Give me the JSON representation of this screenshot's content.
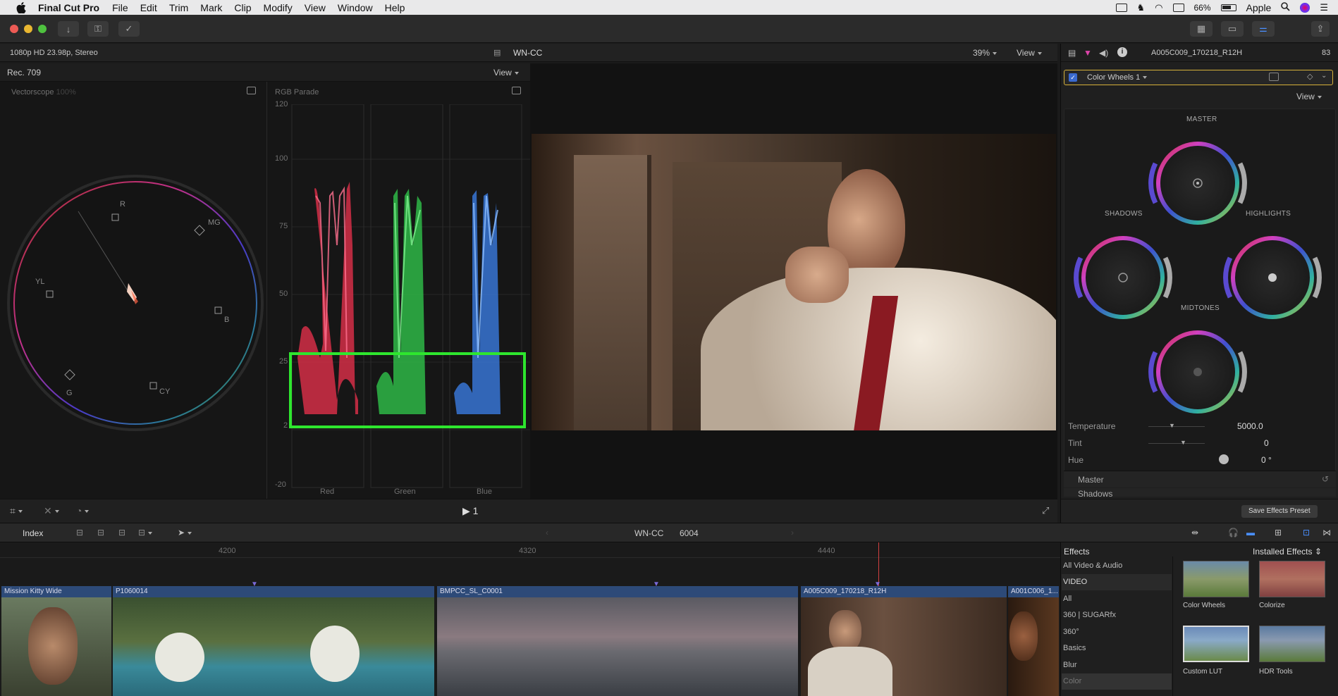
{
  "menubar": {
    "app_name": "Final Cut Pro",
    "items": [
      "File",
      "Edit",
      "Trim",
      "Mark",
      "Clip",
      "Modify",
      "View",
      "Window",
      "Help"
    ],
    "battery": "66%",
    "user": "Apple"
  },
  "viewer_bar": {
    "format": "1080p HD 23.98p, Stereo",
    "project": "WN-CC",
    "zoom": "39%",
    "view_label": "View"
  },
  "scopes": {
    "rec_label": "Rec. 709",
    "view_label": "View",
    "vectorscope_title": "Vectorscope",
    "vectorscope_pct": "100%",
    "parade_title": "RGB Parade",
    "parade_scale": [
      "120",
      "100",
      "75",
      "50",
      "25",
      "2",
      "-20"
    ],
    "parade_channels": [
      "Red",
      "Green",
      "Blue"
    ],
    "vector_targets": [
      "R",
      "MG",
      "YL",
      "B",
      "G",
      "CY"
    ]
  },
  "viewer_controls": {
    "play_label": "1"
  },
  "inspector": {
    "clip_name": "A005C009_170218_R12H",
    "duration": "83",
    "effect_name": "Color Wheels 1",
    "view_label": "View",
    "wheels": {
      "master": "MASTER",
      "shadows": "SHADOWS",
      "highlights": "HIGHLIGHTS",
      "midtones": "MIDTONES"
    },
    "params": [
      {
        "label": "Temperature",
        "value": "5000.0"
      },
      {
        "label": "Tint",
        "value": "0"
      },
      {
        "label": "Hue",
        "value": "0 °"
      }
    ],
    "sections": [
      "Master",
      "Shadows"
    ],
    "save_preset": "Save Effects Preset"
  },
  "timeline": {
    "index_label": "Index",
    "project": "WN-CC",
    "timecode": "6004",
    "ruler": [
      "4200",
      "4320",
      "4440"
    ],
    "clips": [
      {
        "name": "Mission Kitty Wide"
      },
      {
        "name": "P1060014"
      },
      {
        "name": "BMPCC_SL_C0001"
      },
      {
        "name": "A005C009_170218_R12H"
      },
      {
        "name": "A001C006_1..."
      }
    ]
  },
  "effects": {
    "title": "Effects",
    "installed": "Installed Effects",
    "categories": [
      "All Video & Audio",
      "VIDEO",
      "All",
      "360 | SUGARfx",
      "360°",
      "Basics",
      "Blur",
      "Color"
    ],
    "items": [
      "Color Wheels",
      "Colorize",
      "Custom LUT",
      "HDR Tools"
    ]
  },
  "colors": {
    "accent_green": "#2ee62e",
    "selection_yellow": "#d6b13a",
    "clip_blue": "#2d4a78"
  }
}
